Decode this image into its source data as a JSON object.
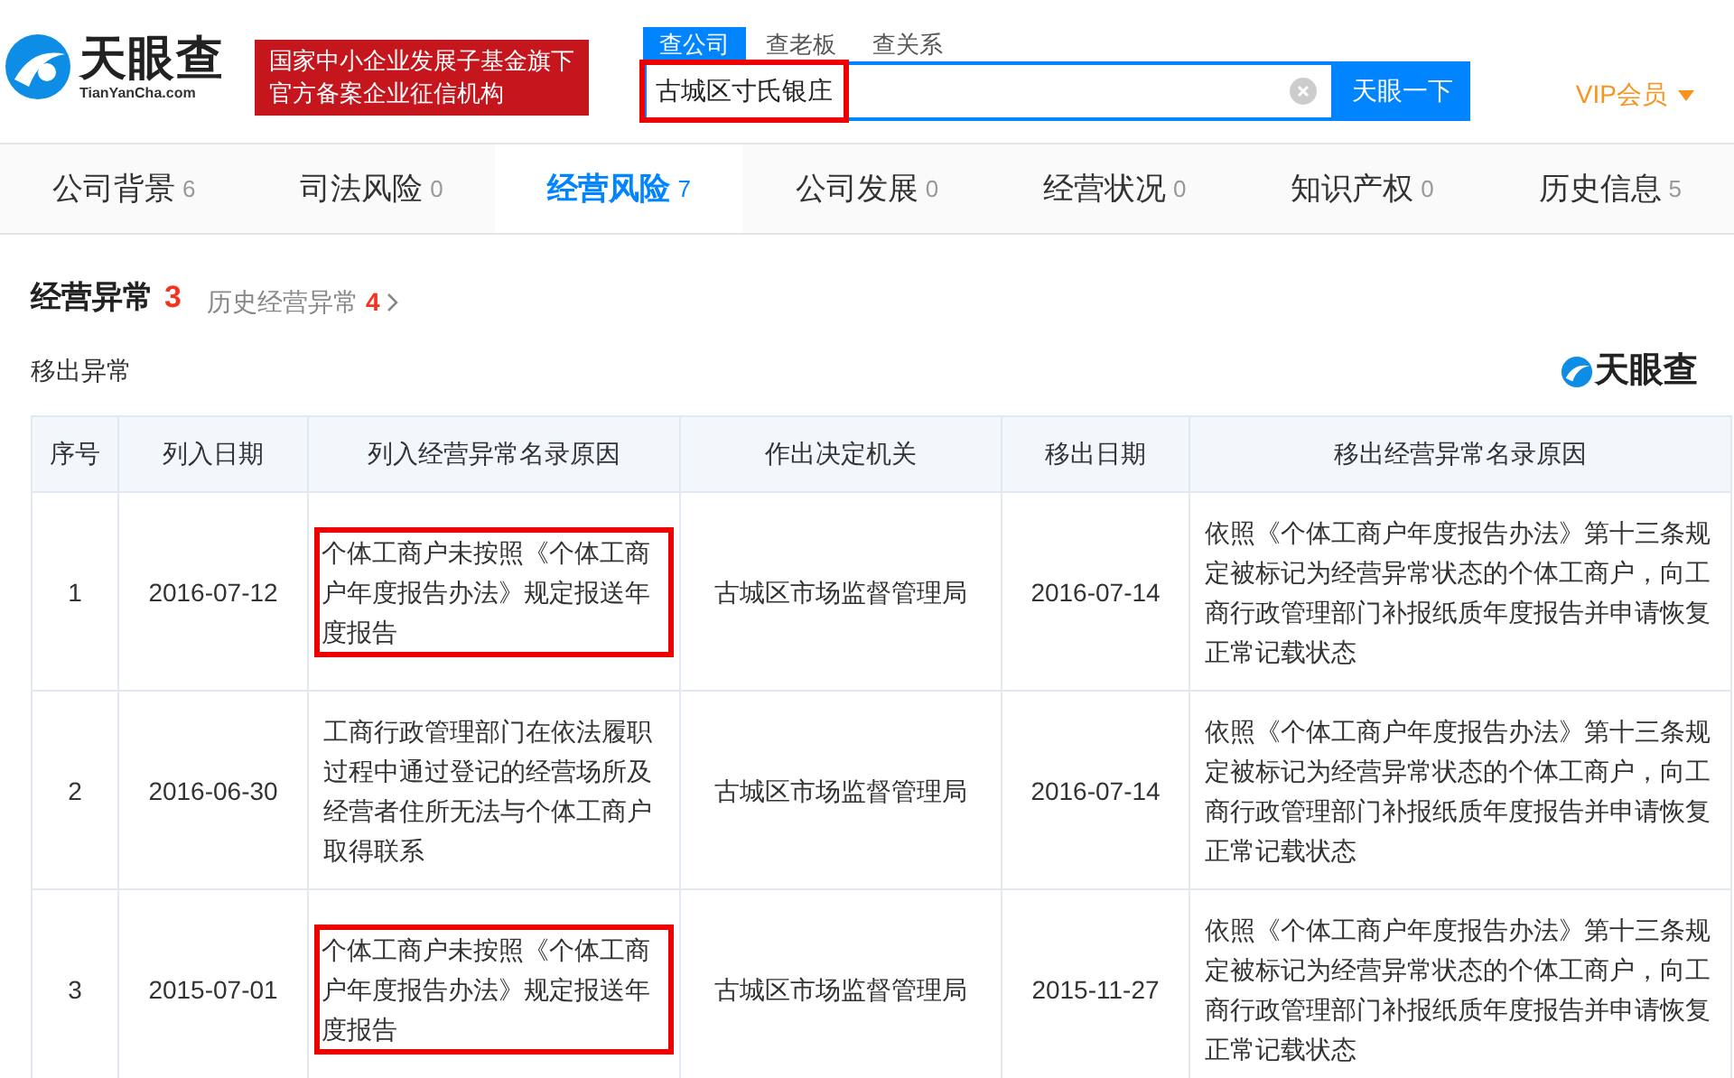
{
  "header": {
    "logo_text": "天眼查",
    "logo_domain": "TianYanCha.com",
    "badge_lines": [
      "国家中小企业发展子基金旗下",
      "官方备案企业征信机构"
    ],
    "search_tabs": [
      {
        "label": "查公司",
        "selected": true
      },
      {
        "label": "查老板",
        "selected": false
      },
      {
        "label": "查关系",
        "selected": false
      }
    ],
    "search": {
      "value": "古城区寸氏银庄",
      "highlighted": true
    },
    "search_button": "天眼一下",
    "vip": "VIP会员"
  },
  "tabs": [
    {
      "label": "公司背景",
      "count": "6",
      "selected": false
    },
    {
      "label": "司法风险",
      "count": "0",
      "selected": false
    },
    {
      "label": "经营风险",
      "count": "7",
      "selected": true
    },
    {
      "label": "公司发展",
      "count": "0",
      "selected": false
    },
    {
      "label": "经营状况",
      "count": "0",
      "selected": false
    },
    {
      "label": "知识产权",
      "count": "0",
      "selected": false
    },
    {
      "label": "历史信息",
      "count": "5",
      "selected": false
    }
  ],
  "section": {
    "title": "经营异常",
    "count": "3",
    "history_label": "历史经营异常",
    "history_count": "4",
    "subtitle": "移出异常",
    "brand": "天眼查"
  },
  "table": {
    "columns": [
      "序号",
      "列入日期",
      "列入经营异常名录原因",
      "作出决定机关",
      "移出日期",
      "移出经营异常名录原因"
    ],
    "rows": [
      {
        "cells": [
          "1",
          "2016-07-12",
          "个体工商户未按照《个体工商户年度报告办法》规定报送年度报告",
          "古城区市场监督管理局",
          "2016-07-14",
          "依照《个体工商户年度报告办法》第十三条规定被标记为经营异常状态的个体工商户，向工商行政管理部门补报纸质年度报告并申请恢复正常记载状态"
        ],
        "highlighted": true
      },
      {
        "cells": [
          "2",
          "2016-06-30",
          "工商行政管理部门在依法履职过程中通过登记的经营场所及经营者住所无法与个体工商户取得联系",
          "古城区市场监督管理局",
          "2016-07-14",
          "依照《个体工商户年度报告办法》第十三条规定被标记为经营异常状态的个体工商户，向工商行政管理部门补报纸质年度报告并申请恢复正常记载状态"
        ],
        "highlighted": false
      },
      {
        "cells": [
          "3",
          "2015-07-01",
          "个体工商户未按照《个体工商户年度报告办法》规定报送年度报告",
          "古城区市场监督管理局",
          "2015-11-27",
          "依照《个体工商户年度报告办法》第十三条规定被标记为经营异常状态的个体工商户，向工商行政管理部门补报纸质年度报告并申请恢复正常记载状态"
        ],
        "highlighted": true
      }
    ]
  }
}
